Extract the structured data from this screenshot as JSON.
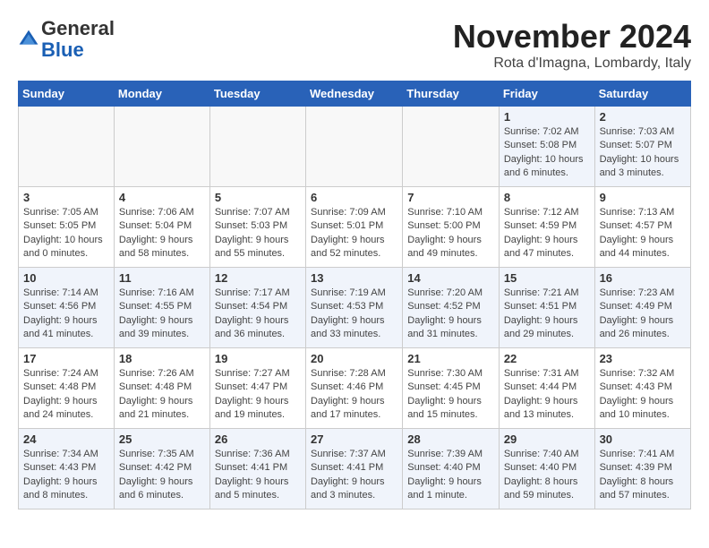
{
  "header": {
    "logo": {
      "line1": "General",
      "line2": "Blue"
    },
    "title": "November 2024",
    "location": "Rota d'Imagna, Lombardy, Italy"
  },
  "weekdays": [
    "Sunday",
    "Monday",
    "Tuesday",
    "Wednesday",
    "Thursday",
    "Friday",
    "Saturday"
  ],
  "weeks": [
    [
      {
        "day": "",
        "info": ""
      },
      {
        "day": "",
        "info": ""
      },
      {
        "day": "",
        "info": ""
      },
      {
        "day": "",
        "info": ""
      },
      {
        "day": "",
        "info": ""
      },
      {
        "day": "1",
        "info": "Sunrise: 7:02 AM\nSunset: 5:08 PM\nDaylight: 10 hours\nand 6 minutes."
      },
      {
        "day": "2",
        "info": "Sunrise: 7:03 AM\nSunset: 5:07 PM\nDaylight: 10 hours\nand 3 minutes."
      }
    ],
    [
      {
        "day": "3",
        "info": "Sunrise: 7:05 AM\nSunset: 5:05 PM\nDaylight: 10 hours\nand 0 minutes."
      },
      {
        "day": "4",
        "info": "Sunrise: 7:06 AM\nSunset: 5:04 PM\nDaylight: 9 hours\nand 58 minutes."
      },
      {
        "day": "5",
        "info": "Sunrise: 7:07 AM\nSunset: 5:03 PM\nDaylight: 9 hours\nand 55 minutes."
      },
      {
        "day": "6",
        "info": "Sunrise: 7:09 AM\nSunset: 5:01 PM\nDaylight: 9 hours\nand 52 minutes."
      },
      {
        "day": "7",
        "info": "Sunrise: 7:10 AM\nSunset: 5:00 PM\nDaylight: 9 hours\nand 49 minutes."
      },
      {
        "day": "8",
        "info": "Sunrise: 7:12 AM\nSunset: 4:59 PM\nDaylight: 9 hours\nand 47 minutes."
      },
      {
        "day": "9",
        "info": "Sunrise: 7:13 AM\nSunset: 4:57 PM\nDaylight: 9 hours\nand 44 minutes."
      }
    ],
    [
      {
        "day": "10",
        "info": "Sunrise: 7:14 AM\nSunset: 4:56 PM\nDaylight: 9 hours\nand 41 minutes."
      },
      {
        "day": "11",
        "info": "Sunrise: 7:16 AM\nSunset: 4:55 PM\nDaylight: 9 hours\nand 39 minutes."
      },
      {
        "day": "12",
        "info": "Sunrise: 7:17 AM\nSunset: 4:54 PM\nDaylight: 9 hours\nand 36 minutes."
      },
      {
        "day": "13",
        "info": "Sunrise: 7:19 AM\nSunset: 4:53 PM\nDaylight: 9 hours\nand 33 minutes."
      },
      {
        "day": "14",
        "info": "Sunrise: 7:20 AM\nSunset: 4:52 PM\nDaylight: 9 hours\nand 31 minutes."
      },
      {
        "day": "15",
        "info": "Sunrise: 7:21 AM\nSunset: 4:51 PM\nDaylight: 9 hours\nand 29 minutes."
      },
      {
        "day": "16",
        "info": "Sunrise: 7:23 AM\nSunset: 4:49 PM\nDaylight: 9 hours\nand 26 minutes."
      }
    ],
    [
      {
        "day": "17",
        "info": "Sunrise: 7:24 AM\nSunset: 4:48 PM\nDaylight: 9 hours\nand 24 minutes."
      },
      {
        "day": "18",
        "info": "Sunrise: 7:26 AM\nSunset: 4:48 PM\nDaylight: 9 hours\nand 21 minutes."
      },
      {
        "day": "19",
        "info": "Sunrise: 7:27 AM\nSunset: 4:47 PM\nDaylight: 9 hours\nand 19 minutes."
      },
      {
        "day": "20",
        "info": "Sunrise: 7:28 AM\nSunset: 4:46 PM\nDaylight: 9 hours\nand 17 minutes."
      },
      {
        "day": "21",
        "info": "Sunrise: 7:30 AM\nSunset: 4:45 PM\nDaylight: 9 hours\nand 15 minutes."
      },
      {
        "day": "22",
        "info": "Sunrise: 7:31 AM\nSunset: 4:44 PM\nDaylight: 9 hours\nand 13 minutes."
      },
      {
        "day": "23",
        "info": "Sunrise: 7:32 AM\nSunset: 4:43 PM\nDaylight: 9 hours\nand 10 minutes."
      }
    ],
    [
      {
        "day": "24",
        "info": "Sunrise: 7:34 AM\nSunset: 4:43 PM\nDaylight: 9 hours\nand 8 minutes."
      },
      {
        "day": "25",
        "info": "Sunrise: 7:35 AM\nSunset: 4:42 PM\nDaylight: 9 hours\nand 6 minutes."
      },
      {
        "day": "26",
        "info": "Sunrise: 7:36 AM\nSunset: 4:41 PM\nDaylight: 9 hours\nand 5 minutes."
      },
      {
        "day": "27",
        "info": "Sunrise: 7:37 AM\nSunset: 4:41 PM\nDaylight: 9 hours\nand 3 minutes."
      },
      {
        "day": "28",
        "info": "Sunrise: 7:39 AM\nSunset: 4:40 PM\nDaylight: 9 hours\nand 1 minute."
      },
      {
        "day": "29",
        "info": "Sunrise: 7:40 AM\nSunset: 4:40 PM\nDaylight: 8 hours\nand 59 minutes."
      },
      {
        "day": "30",
        "info": "Sunrise: 7:41 AM\nSunset: 4:39 PM\nDaylight: 8 hours\nand 57 minutes."
      }
    ]
  ]
}
